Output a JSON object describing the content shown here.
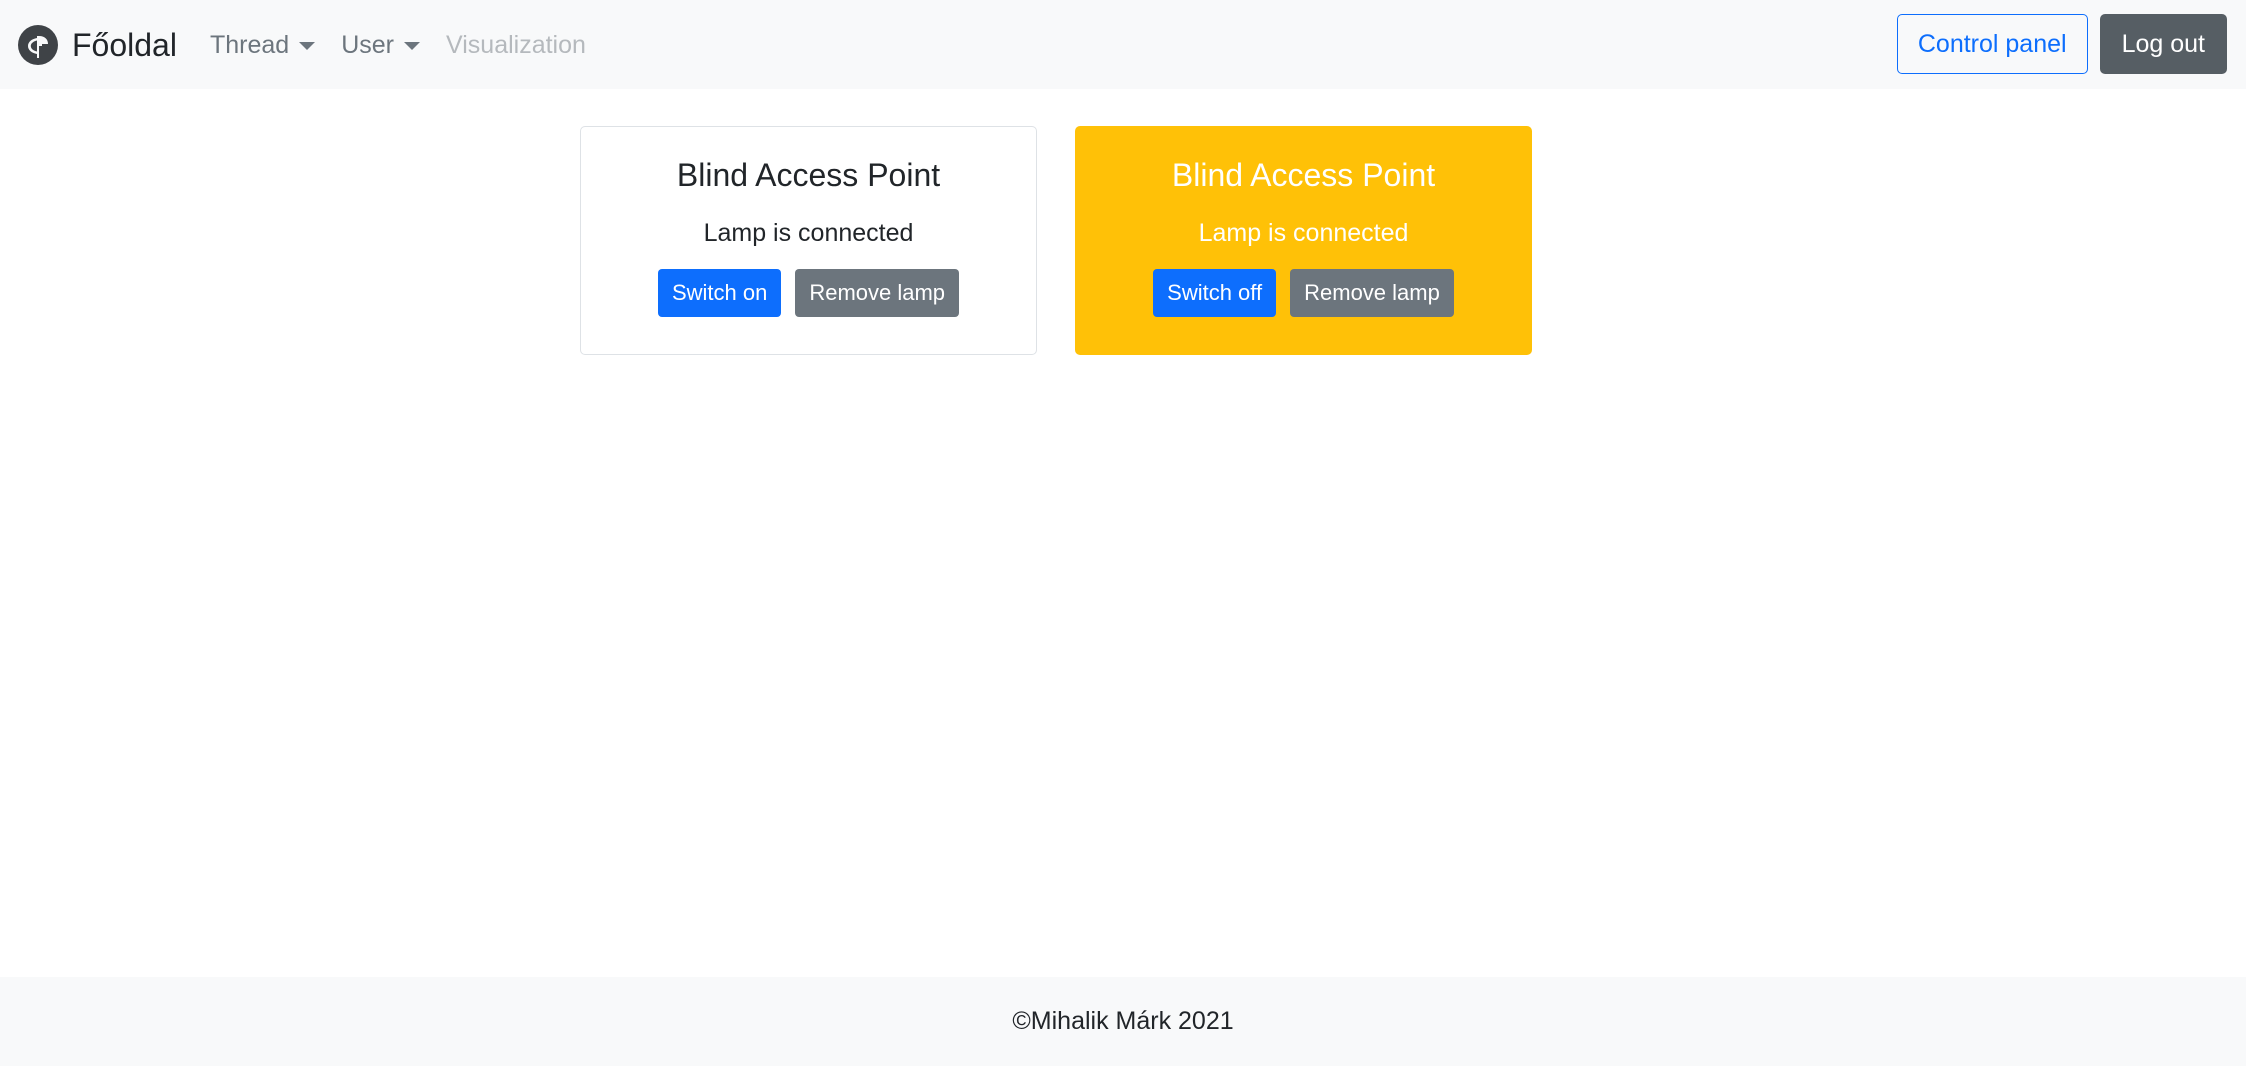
{
  "navbar": {
    "brand": "Főoldal",
    "links": [
      {
        "label": "Thread",
        "dropdown": true
      },
      {
        "label": "User",
        "dropdown": true
      },
      {
        "label": "Visualization",
        "disabled": true
      }
    ],
    "control_panel_label": "Control panel",
    "logout_label": "Log out"
  },
  "cards": [
    {
      "title": "Blind Access Point",
      "status": "Lamp is connected",
      "toggle_label": "Switch on",
      "remove_label": "Remove lamp",
      "active": false
    },
    {
      "title": "Blind Access Point",
      "status": "Lamp is connected",
      "toggle_label": "Switch off",
      "remove_label": "Remove lamp",
      "active": true
    }
  ],
  "footer": {
    "text": "©Mihalik Márk 2021"
  },
  "colors": {
    "primary": "#0d6efd",
    "secondary": "#6c757d",
    "warning": "#ffc107",
    "navbar_bg": "#f8f9fa",
    "logout_bg": "#565e64"
  }
}
